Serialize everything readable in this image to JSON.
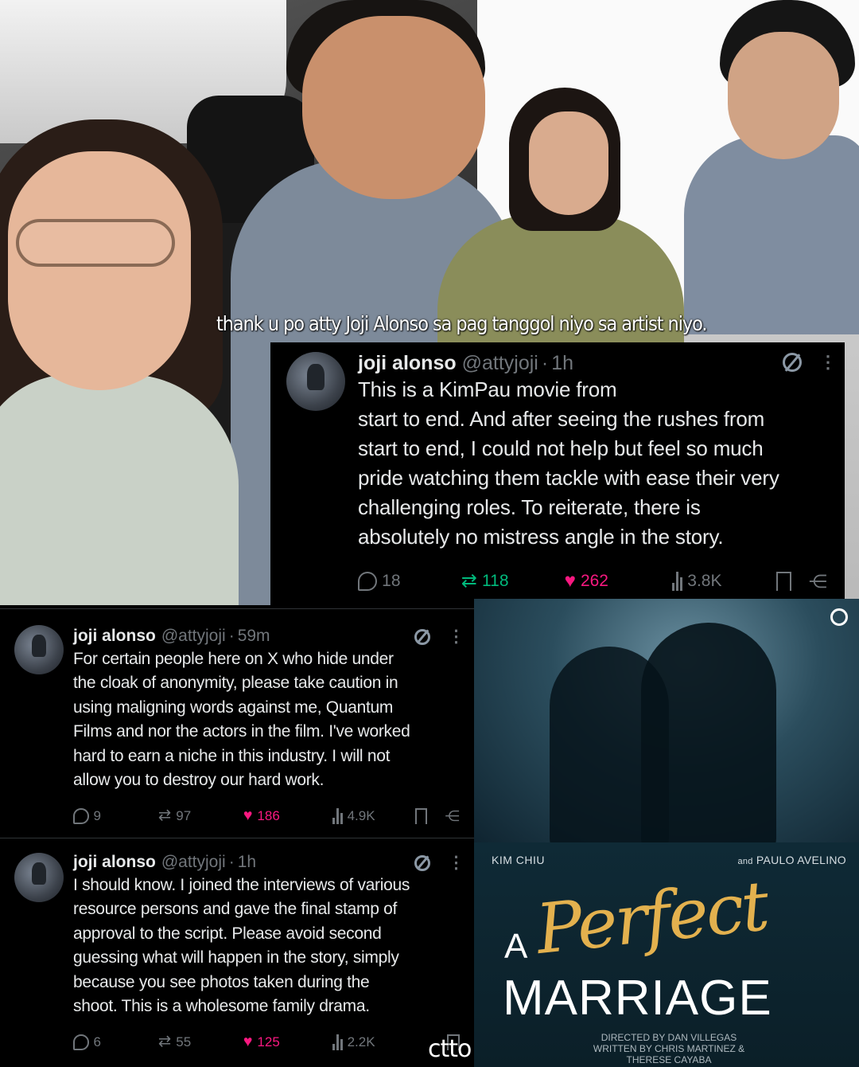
{
  "caption": "thank u po atty Joji Alonso sa pag tanggol niyo sa artist niyo.",
  "tweets": [
    {
      "name": "joji alonso",
      "handle": "@attyjoji",
      "time": "1h",
      "text": "This is a KimPau movie from\nstart to end. And after seeing the rushes from\nstart to end, I could not help but feel so much\npride watching them tackle with ease their very\nchallenging roles. To reiterate, there is\nabsolutely no mistress angle in the story.",
      "replies": "18",
      "reposts": "118",
      "likes": "262",
      "views": "3.8K"
    },
    {
      "name": "joji alonso",
      "handle": "@attyjoji",
      "time": "59m",
      "text": "For certain people here on X who hide under\nthe cloak of anonymity, please take caution in\nusing maligning words against me, Quantum\nFilms and nor the actors in the film. I've worked\nhard to earn a niche in this industry. I will not\nallow you to destroy our hard work.",
      "replies": "9",
      "reposts": "97",
      "likes": "186",
      "views": "4.9K"
    },
    {
      "name": "joji alonso",
      "handle": "@attyjoji",
      "time": "1h",
      "text": "I should know. I joined the interviews of various\nresource persons and gave the final stamp of\napproval to the script. Please avoid second\nguessing what will happen in the story, simply\nbecause you see photos taken during the\nshoot. This is a wholesome family drama.",
      "replies": "6",
      "reposts": "55",
      "likes": "125",
      "views": "2.2K"
    }
  ],
  "poster": {
    "cast_left": "KIM CHIU",
    "cast_right_prefix": "and",
    "cast_right": "PAULO AVELINO",
    "title_a": "A",
    "title_perfect": "Perfect",
    "title_marriage": "MARRIAGE",
    "credit_directed": "directed by DAN VILLEGAS",
    "credit_written": "written by CHRIS MARTINEZ &",
    "credit_written2": "THERESE CAYABA"
  },
  "watermark": "ctto",
  "icons": {
    "reply": "reply-bubble-icon",
    "repost": "repost-icon",
    "like": "heart-icon",
    "views": "views-bars-icon",
    "bookmark": "bookmark-icon",
    "share": "share-icon",
    "grok": "grok-icon",
    "more": "more-icon"
  },
  "colors": {
    "like": "#f91880",
    "repost_active": "#00ba7c",
    "muted": "#71767b",
    "poster_gold": "#e3b14e"
  }
}
